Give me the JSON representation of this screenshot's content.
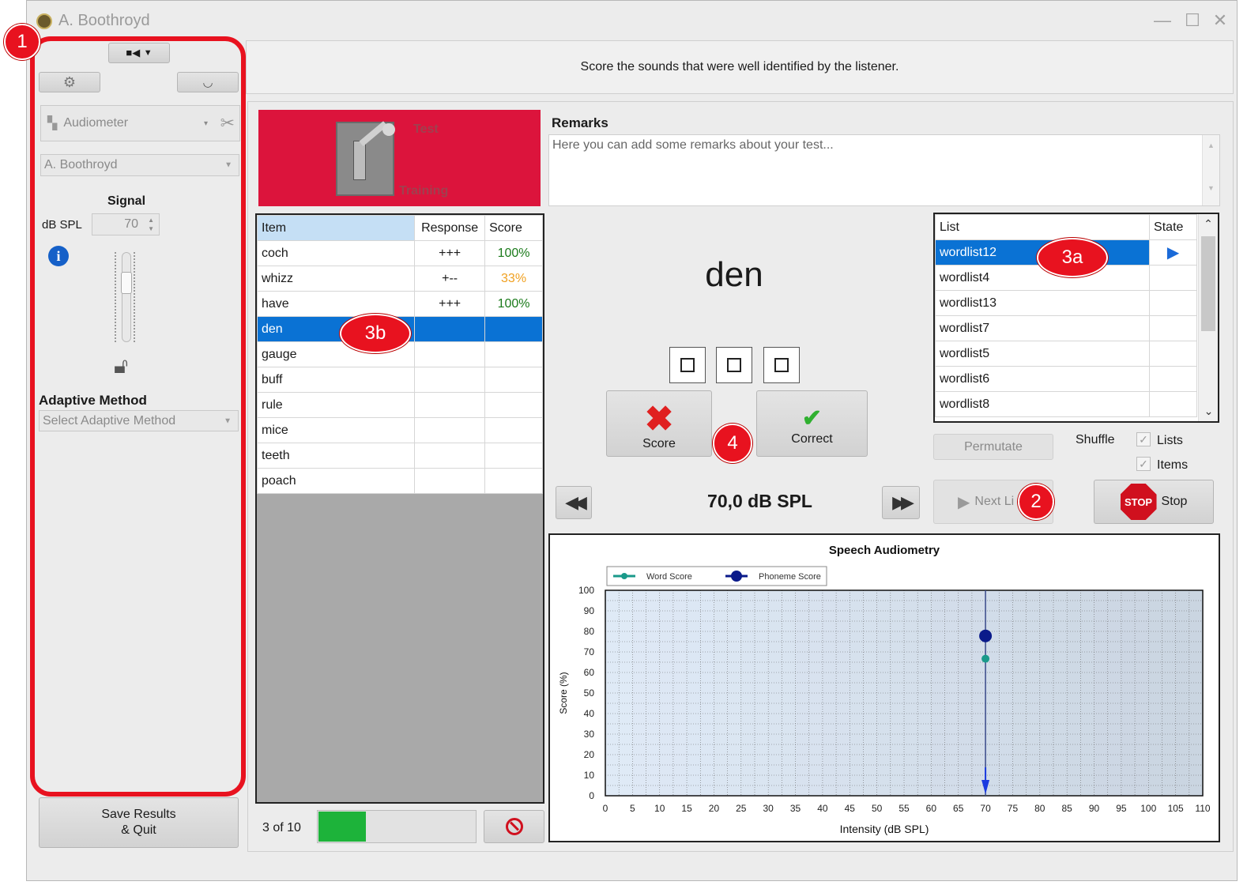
{
  "window": {
    "title": "A. Boothroyd"
  },
  "left_panel": {
    "device_label": "Audiometer",
    "profile_label": "A. Boothroyd",
    "signal_title": "Signal",
    "db_unit": "dB SPL",
    "db_value": "70",
    "adaptive_title": "Adaptive Method",
    "adaptive_placeholder": "Select Adaptive Method",
    "save_line1": "Save Results",
    "save_line2": "& Quit"
  },
  "instruction": "Score the sounds that were well identified by the listener.",
  "mode_switch": {
    "test_label": "Test",
    "training_label": "Training"
  },
  "remarks": {
    "title": "Remarks",
    "placeholder": "Here you can add some remarks about your test..."
  },
  "items_table": {
    "headers": [
      "Item",
      "Response",
      "Score"
    ],
    "rows": [
      {
        "item": "coch",
        "response": "+++",
        "score": "100%"
      },
      {
        "item": "whizz",
        "response": "+--",
        "score": "33%"
      },
      {
        "item": "have",
        "response": "+++",
        "score": "100%"
      },
      {
        "item": "den",
        "response": "",
        "score": ""
      },
      {
        "item": "gauge",
        "response": "",
        "score": ""
      },
      {
        "item": "buff",
        "response": "",
        "score": ""
      },
      {
        "item": "rule",
        "response": "",
        "score": ""
      },
      {
        "item": "mice",
        "response": "",
        "score": ""
      },
      {
        "item": "teeth",
        "response": "",
        "score": ""
      },
      {
        "item": "poach",
        "response": "",
        "score": ""
      }
    ],
    "selected_index": 3
  },
  "progress": {
    "text": "3 of 10",
    "fraction": 0.3
  },
  "current_word": "den",
  "score_buttons": {
    "score_label": "Score",
    "correct_label": "Correct"
  },
  "level": {
    "text": "70,0 dB SPL"
  },
  "list_table": {
    "headers": [
      "List",
      "State"
    ],
    "rows": [
      "wordlist12",
      "wordlist4",
      "wordlist13",
      "wordlist7",
      "wordlist5",
      "wordlist6",
      "wordlist8"
    ],
    "selected_index": 0
  },
  "list_controls": {
    "permutate_label": "Permutate",
    "shuffle_label": "Shuffle",
    "lists_label": "Lists",
    "items_label": "Items",
    "next_label": "Next Li",
    "stop_badge": "STOP",
    "stop_label": "Stop"
  },
  "annotations": [
    "1",
    "2",
    "3a",
    "3b",
    "4"
  ],
  "colors": {
    "accent_red": "#dc143c",
    "selection_blue": "#0a72d4",
    "progress_green": "#1db33a",
    "score_green": "#1a7a1a",
    "score_orange": "#f0a020"
  },
  "chart_data": {
    "type": "scatter",
    "title": "Speech Audiometry",
    "xlabel": "Intensity (dB SPL)",
    "ylabel": "Score (%)",
    "xlim": [
      0,
      110
    ],
    "ylim": [
      0,
      100
    ],
    "x_ticks": [
      0,
      5,
      10,
      15,
      20,
      25,
      30,
      35,
      40,
      45,
      50,
      55,
      60,
      65,
      70,
      75,
      80,
      85,
      90,
      95,
      100,
      105,
      110
    ],
    "y_ticks": [
      0,
      10,
      20,
      30,
      40,
      50,
      60,
      70,
      80,
      90,
      100
    ],
    "legend_position": "top-left",
    "grid": true,
    "series": [
      {
        "name": "Word Score",
        "color": "#1a9a8a",
        "points": [
          [
            70,
            66.7
          ]
        ]
      },
      {
        "name": "Phoneme Score",
        "color": "#0a1a8a",
        "points": [
          [
            70,
            77.8
          ]
        ]
      }
    ],
    "marker_x": 70
  }
}
